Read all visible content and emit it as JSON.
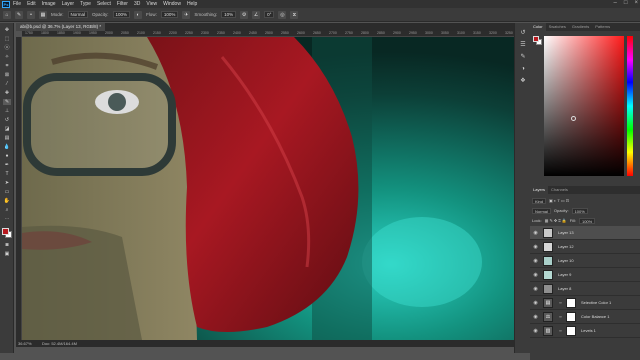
{
  "menu": {
    "items": [
      "File",
      "Edit",
      "Image",
      "Layer",
      "Type",
      "Select",
      "Filter",
      "3D",
      "View",
      "Window",
      "Help"
    ]
  },
  "options": {
    "mode_label": "Mode:",
    "mode_value": "Normal",
    "opacity_label": "Opacity:",
    "opacity_value": "100%",
    "flow_label": "Flow:",
    "flow_value": "100%",
    "smoothing_label": "Smoothing:",
    "smoothing_value": "10%",
    "angle_value": "0°"
  },
  "document": {
    "tab_title": "ab@b.psd @ 36.7% (Layer 13, RGB/8) *"
  },
  "ruler": {
    "top": [
      "1750",
      "1800",
      "1850",
      "1900",
      "1950",
      "2000",
      "2050",
      "2100",
      "2150",
      "2200",
      "2250",
      "2300",
      "2350",
      "2400",
      "2450",
      "2500",
      "2550",
      "2600",
      "2650",
      "2700",
      "2750",
      "2800",
      "2850",
      "2900",
      "2950",
      "3000",
      "3050",
      "3100",
      "3150",
      "3200",
      "3250"
    ]
  },
  "status": {
    "zoom": "36.67%",
    "doc": "Doc: 52.4M/164.4M"
  },
  "panels": {
    "color_tabs": [
      "Color",
      "Swatches",
      "Gradients",
      "Patterns"
    ],
    "layers_tabs": [
      "Layers",
      "Channels"
    ],
    "kind_label": "Kind",
    "blend_mode": "Normal",
    "opacity_label": "Opacity:",
    "opacity_value": "100%",
    "lock_label": "Lock:",
    "fill_label": "Fill:",
    "fill_value": "100%"
  },
  "layers": [
    {
      "name": "Layer 13",
      "selected": true
    },
    {
      "name": "Layer 12",
      "selected": false
    },
    {
      "name": "Layer 10",
      "selected": false
    },
    {
      "name": "Layer 9",
      "selected": false
    },
    {
      "name": "Layer 8",
      "selected": false
    },
    {
      "name": "Selective Color 1",
      "selected": false
    },
    {
      "name": "Color Balance 1",
      "selected": false
    },
    {
      "name": "Levels 1",
      "selected": false
    }
  ],
  "colors": {
    "accent": "#b8191f",
    "hue": "#ff1a1a",
    "foreground": "#b8191f",
    "background": "#ffffff"
  }
}
